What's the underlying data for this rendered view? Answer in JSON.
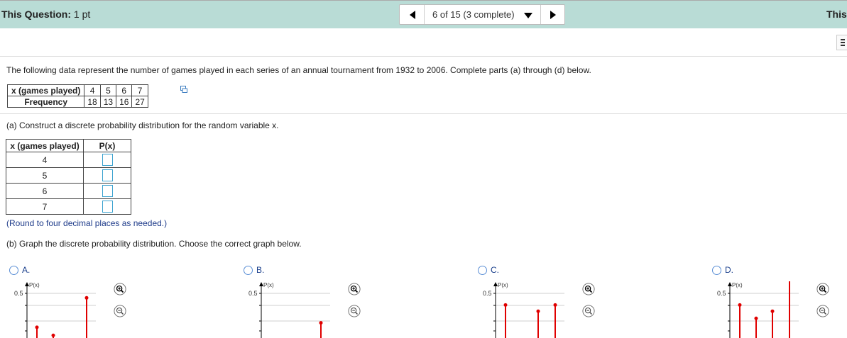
{
  "header": {
    "question_label": "This Question:",
    "points": "1 pt",
    "progress": "6 of 15 (3 complete)",
    "right_label": "This"
  },
  "intro": "The following data represent the number of games played in each series of an annual tournament from 1932 to 2006. Complete parts (a) through (d) below.",
  "data_table": {
    "row_x_label": "x (games played)",
    "row_f_label": "Frequency",
    "x": [
      "4",
      "5",
      "6",
      "7"
    ],
    "freq": [
      "18",
      "13",
      "16",
      "27"
    ]
  },
  "part_a": {
    "prompt": "(a) Construct a discrete probability distribution for the random variable x.",
    "col_x": "x (games played)",
    "col_p": "P(x)",
    "rows": [
      "4",
      "5",
      "6",
      "7"
    ],
    "note": "(Round to four decimal places as needed.)"
  },
  "part_b": {
    "prompt": "(b) Graph the discrete probability distribution. Choose the correct graph below.",
    "options": [
      {
        "label": "A.",
        "axis_label": "P(x)",
        "tick": "0.5",
        "values": [
          0.12,
          0.03,
          null,
          0.45
        ]
      },
      {
        "label": "B.",
        "axis_label": "P(x)",
        "tick": "0.5",
        "values": [
          null,
          null,
          null,
          0.17
        ]
      },
      {
        "label": "C.",
        "axis_label": "P(x)",
        "tick": "0.5",
        "values": [
          0.37,
          null,
          0.3,
          0.37
        ]
      },
      {
        "label": "D.",
        "axis_label": "P(x)",
        "tick": "0.5",
        "values": [
          0.37,
          0.22,
          0.3,
          0.66
        ]
      }
    ]
  }
}
